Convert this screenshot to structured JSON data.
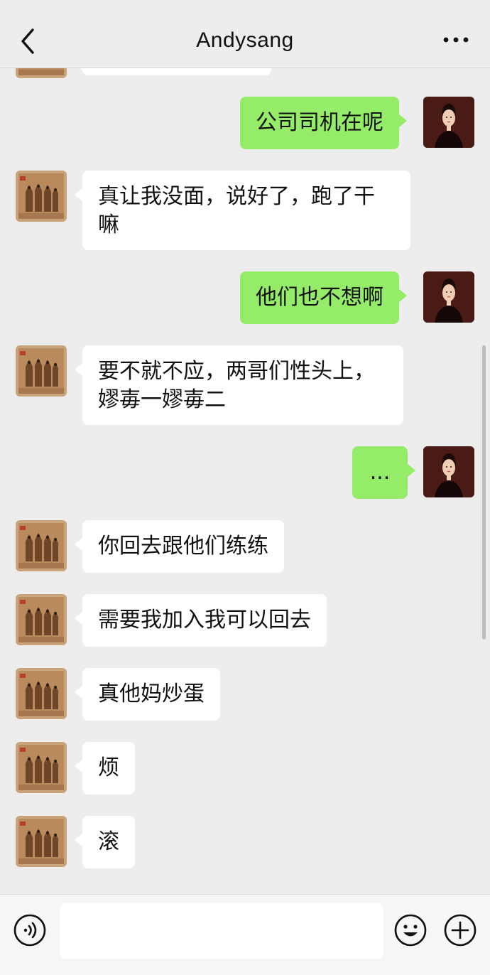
{
  "header": {
    "title": "Andysang",
    "back_icon": "chevron-left-icon",
    "more_icon": "more-horizontal-icon"
  },
  "colors": {
    "background": "#ededed",
    "sent_bubble": "#95ec69",
    "received_bubble": "#ffffff"
  },
  "messages": [
    {
      "side": "sent",
      "text": "公司司机在呢"
    },
    {
      "side": "received",
      "text": "真让我没面，说好了，跑了干嘛"
    },
    {
      "side": "sent",
      "text": "他们也不想啊"
    },
    {
      "side": "received",
      "text": "要不就不应，两哥们性头上，嫪毐一嫪毐二"
    },
    {
      "side": "sent",
      "text": "..."
    },
    {
      "side": "received",
      "text": "你回去跟他们练练"
    },
    {
      "side": "received",
      "text": "需要我加入我可以回去"
    },
    {
      "side": "received",
      "text": "真他妈炒蛋"
    },
    {
      "side": "received",
      "text": "烦"
    },
    {
      "side": "received",
      "text": "滚"
    }
  ],
  "input_bar": {
    "voice_icon": "voice-icon",
    "emoji_icon": "emoji-icon",
    "plus_icon": "plus-circle-icon"
  }
}
